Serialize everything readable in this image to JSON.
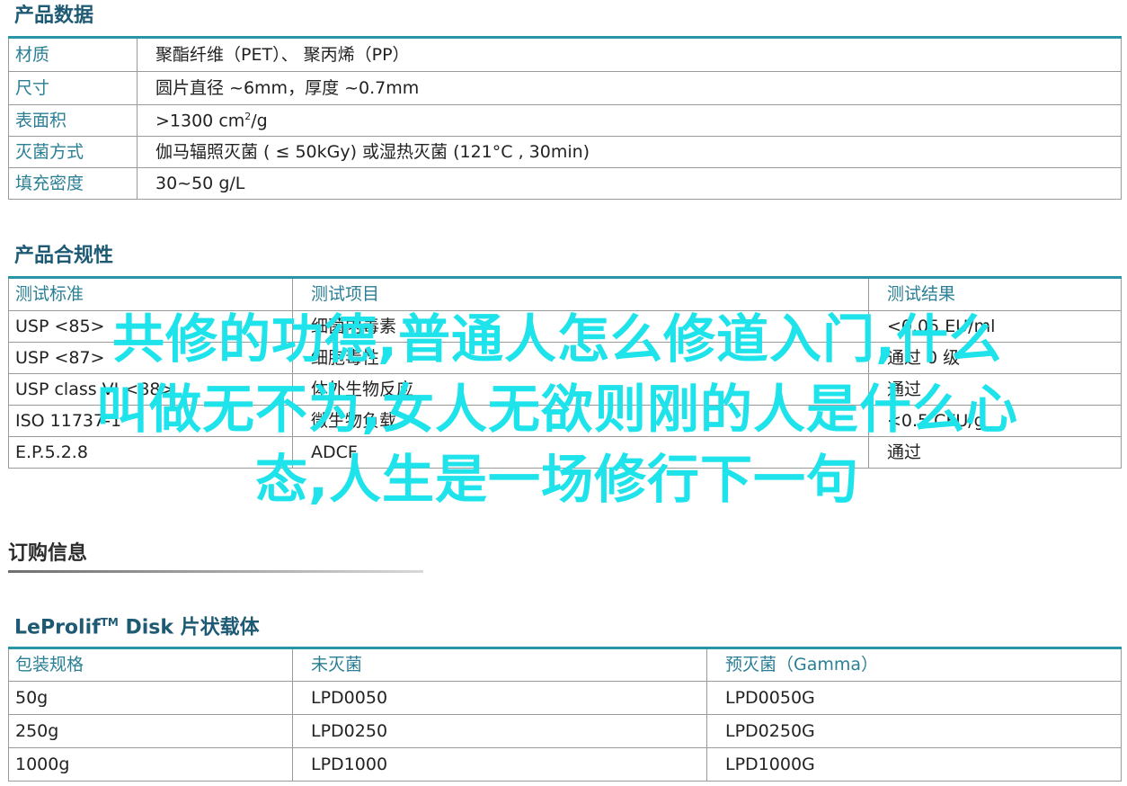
{
  "sections": {
    "product_data": "产品数据",
    "compliance": "产品合规性",
    "order_info": "订购信息",
    "leprolif_prefix": "LeProlif",
    "leprolif_tm": "TM",
    "leprolif_suffix": " Disk 片状载体"
  },
  "product_table": [
    {
      "label": "材质",
      "value": "聚酯纤维（PET）、 聚丙烯（PP）"
    },
    {
      "label": "尺寸",
      "value": "圆片直径 ~6mm，厚度 ~0.7mm"
    },
    {
      "label": "表面积",
      "value_prefix": ">1300 cm",
      "value_sup": "2",
      "value_suffix": "/g"
    },
    {
      "label": "灭菌方式",
      "value": "伽马辐照灭菌 ( ≤ 50kGy) 或湿热灭菌 (121°C , 30min)"
    },
    {
      "label": "填充密度",
      "value": "30~50 g/L"
    }
  ],
  "compliance_table": {
    "headers": [
      "测试标准",
      "测试项目",
      "测试结果"
    ],
    "rows": [
      [
        "USP <85>",
        "细菌内毒素",
        "<0.05 EU/ml"
      ],
      [
        "USP <87>",
        "细胞毒性",
        "通过 0 级"
      ],
      [
        "USP class VI <88>",
        "体外生物反应",
        "通过"
      ],
      [
        "ISO 11737-1",
        "微生物负载",
        "<0.5 CFU/g"
      ],
      [
        "E.P.5.2.8",
        "ADCF",
        "通过"
      ]
    ]
  },
  "order_table": {
    "headers": [
      "包装规格",
      "未灭菌",
      "预灭菌（Gamma）"
    ],
    "rows": [
      [
        "50g",
        "LPD0050",
        "LPD0050G"
      ],
      [
        "250g",
        "LPD0250",
        "LPD0250G"
      ],
      [
        "1000g",
        "LPD1000",
        "LPD1000G"
      ]
    ]
  },
  "watermark": {
    "line1": "共修的功德,普通人怎么修道入门,什么",
    "line2": "叫做无不为,女人无欲则刚的人是什么心",
    "line3": "态,人生是一场修行下一句"
  },
  "colors": {
    "accent": "#2a95a6",
    "heading": "#1e5a73",
    "label": "#2a7f94",
    "watermark": "#1ee3ea"
  }
}
